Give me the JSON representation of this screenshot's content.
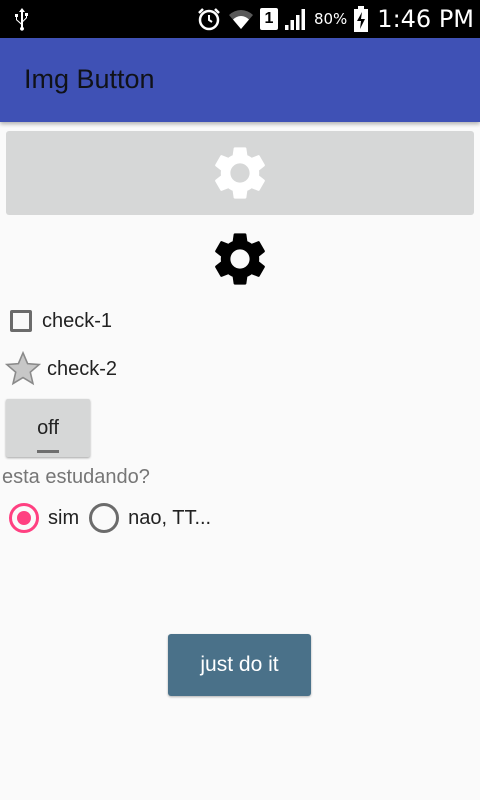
{
  "status_bar": {
    "battery_percent": "80%",
    "time": "1:46 PM",
    "sim_slot": "1",
    "icons": [
      "usb-icon",
      "alarm-icon",
      "wifi-icon",
      "sim-icon",
      "signal-icon",
      "battery-charging-icon"
    ]
  },
  "app_bar": {
    "title": "Img Button",
    "color": "#3f51b5"
  },
  "image_button": {
    "icon": "gear-icon",
    "icon_color": "#ffffff",
    "background": "#d6d7d7"
  },
  "image_view": {
    "icon": "gear-icon",
    "icon_color": "#000000"
  },
  "checks": [
    {
      "label": "check-1",
      "checked": false,
      "style": "checkbox"
    },
    {
      "label": "check-2",
      "checked": false,
      "style": "star"
    }
  ],
  "toggle": {
    "label": "off",
    "checked": false
  },
  "question": "esta estudando?",
  "radios": [
    {
      "label": "sim",
      "checked": true
    },
    {
      "label": "nao, TT...",
      "checked": false
    }
  ],
  "accent_color": "#ff4081",
  "submit_button": {
    "label": "just do it",
    "background": "#4a7189"
  }
}
